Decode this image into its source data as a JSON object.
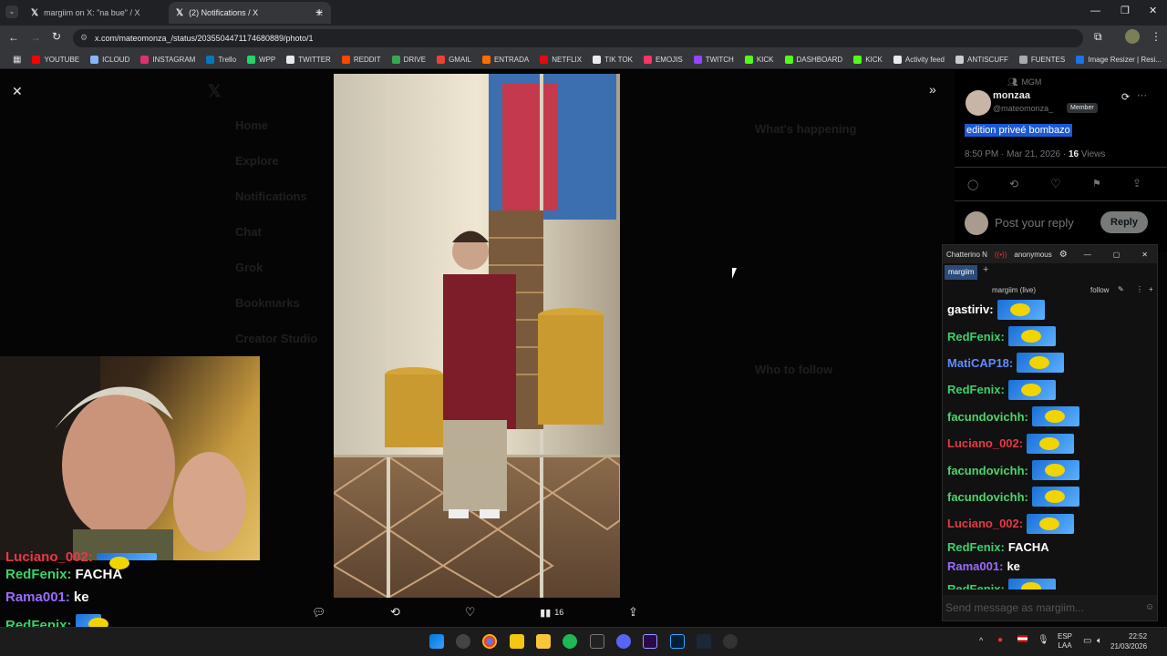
{
  "tabs": [
    {
      "label": "margiim on X: \"na bue\" / X"
    },
    {
      "label": "(2) Notifications / X"
    }
  ],
  "url": "x.com/mateomonza_/status/2035504471174680889/photo/1",
  "bookmarks": [
    "YOUTUBE",
    "ICLOUD",
    "INSTAGRAM",
    "Trello",
    "WPP",
    "TWITTER",
    "REDDIT",
    "DRIVE",
    "GMAIL",
    "ENTRADA",
    "NETFLIX",
    "TIK TOK",
    "EMOJIS",
    "TWITCH",
    "KICK",
    "DASHBOARD",
    "KICK",
    "Activity feed",
    "ANTISCUFF",
    "FUENTES",
    "Image Resizer | Resi..."
  ],
  "bookmark_colors": [
    "#ff0000",
    "#8ab4f8",
    "#e1306c",
    "#0079bf",
    "#25d366",
    "#e8eaed",
    "#ff4500",
    "#34a853",
    "#ea4335",
    "#ff6d00",
    "#e50914",
    "#e8eaed",
    "#ff3366",
    "#9146ff",
    "#53fc18",
    "#53fc18",
    "#53fc18",
    "#e8eaed",
    "#cccccc",
    "#aaaaaa",
    "#1a73e8"
  ],
  "tweet": {
    "community": "MGM",
    "name": "monzaa",
    "handle": "@mateomonza_",
    "badge": "Member",
    "text": "edition priveé bombazo",
    "time": "8:50 PM · Mar 21, 2026 · ",
    "views_count": "16",
    "views_label": " Views",
    "reply_placeholder": "Post your reply",
    "reply_button": "Reply"
  },
  "photo_actions": {
    "views": "16"
  },
  "chatterino": {
    "title": "Chatterino N",
    "user": "anonymous",
    "tab": "margiim",
    "channel": "margiim (live)",
    "follow": "follow",
    "input_placeholder": "Send message as margiim...",
    "messages": [
      {
        "user": "gastiriv:",
        "color": "#ffffff",
        "text": "",
        "emote": true
      },
      {
        "user": "RedFenix:",
        "color": "#3ad16b",
        "text": "",
        "emote": true
      },
      {
        "user": "MatiCAP18:",
        "color": "#5f8cff",
        "text": "",
        "emote": true
      },
      {
        "user": "RedFenix:",
        "color": "#3ad16b",
        "text": "",
        "emote": true
      },
      {
        "user": "facundovichh:",
        "color": "#4ad66b",
        "text": "",
        "emote": true
      },
      {
        "user": "Luciano_002:",
        "color": "#e63946",
        "text": "",
        "emote": true
      },
      {
        "user": "facundovichh:",
        "color": "#4ad66b",
        "text": "",
        "emote": true
      },
      {
        "user": "facundovichh:",
        "color": "#4ad66b",
        "text": "",
        "emote": true
      },
      {
        "user": "Luciano_002:",
        "color": "#e63946",
        "text": "",
        "emote": true
      },
      {
        "user": "RedFenix:",
        "color": "#3ad16b",
        "text": "FACHA",
        "emote": false
      },
      {
        "user": "Rama001:",
        "color": "#9b6bff",
        "text": "ke",
        "emote": false
      },
      {
        "user": "RedFenix:",
        "color": "#3ad16b",
        "text": "",
        "emote": true
      }
    ]
  },
  "overlay_chat": [
    {
      "user": "Luciano_002:",
      "color": "#e63946",
      "text": ""
    },
    {
      "user": "RedFenix:",
      "color": "#3ad16b",
      "text": "FACHA"
    },
    {
      "user": "Rama001:",
      "color": "#9b6bff",
      "text": "ke"
    },
    {
      "user": "RedFenix:",
      "color": "#3ad16b",
      "text": ""
    }
  ],
  "background_nav": [
    "Home",
    "Explore",
    "Notifications",
    "Chat",
    "Grok",
    "Bookmarks",
    "Creator Studio"
  ],
  "background_right": {
    "happening": "What's happening",
    "follow": "Who to follow"
  },
  "tray": {
    "lang": "ESP",
    "lang2": "LAA",
    "time": "22:52",
    "date": "21/03/2026"
  }
}
